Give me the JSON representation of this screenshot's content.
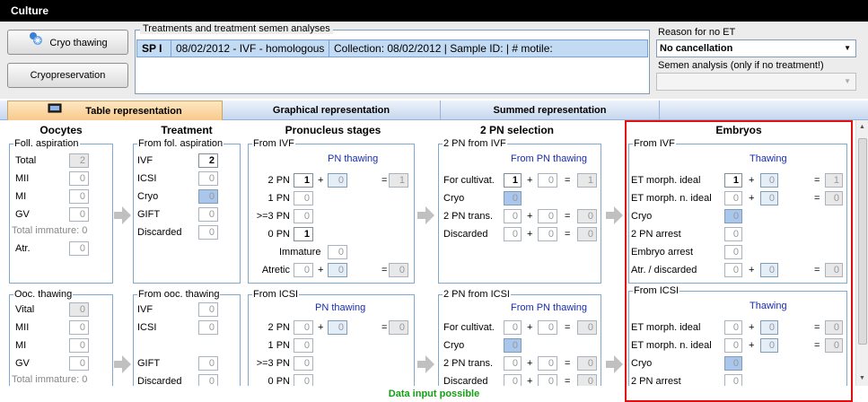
{
  "window": {
    "title": "Culture"
  },
  "toolbar": {
    "cryo_thawing": "Cryo thawing",
    "cryopreservation": "Cryopreservation"
  },
  "treatments": {
    "legend": "Treatments and treatment semen analyses",
    "row": {
      "code": "SP I",
      "date": "08/02/2012 - IVF - homologous",
      "collection": "Collection: 08/02/2012 | Sample ID:  | # motile:"
    }
  },
  "reason": {
    "label": "Reason for no ET",
    "value": "No cancellation"
  },
  "semen": {
    "label": "Semen analysis (only if no treatment!)",
    "value": ""
  },
  "tabs": [
    "Table representation",
    "Graphical representation",
    "Summed representation"
  ],
  "columns": {
    "oocytes": "Oocytes",
    "treatment": "Treatment",
    "pronucleus": "Pronucleus stages",
    "selection": "2 PN selection",
    "embryos": "Embryos"
  },
  "oocytes": {
    "aspiration": {
      "legend": "Foll. aspiration",
      "total": "Total",
      "total_v": "2",
      "mii": "MII",
      "mii_v": "0",
      "mi": "MI",
      "mi_v": "0",
      "gv": "GV",
      "gv_v": "0",
      "immature": "Total immature: 0",
      "atr": "Atr.",
      "atr_v": "0"
    },
    "thawing": {
      "legend": "Ooc. thawing",
      "vital": "Vital",
      "vital_v": "0",
      "mii": "MII",
      "mii_v": "0",
      "mi": "MI",
      "mi_v": "0",
      "gv": "GV",
      "gv_v": "0",
      "immature": "Total immature: 0"
    }
  },
  "treatment": {
    "aspiration": {
      "legend": "From fol. aspiration",
      "ivf": "IVF",
      "ivf_v": "2",
      "icsi": "ICSI",
      "icsi_v": "0",
      "cryo": "Cryo",
      "cryo_v": "0",
      "gift": "GIFT",
      "gift_v": "0",
      "discarded": "Discarded",
      "discarded_v": "0"
    },
    "thawing": {
      "legend": "From ooc. thawing",
      "ivf": "IVF",
      "ivf_v": "0",
      "icsi": "ICSI",
      "icsi_v": "0",
      "gift": "GIFT",
      "gift_v": "0",
      "discarded": "Discarded",
      "discarded_v": "0"
    }
  },
  "pronucleus": {
    "ivf": {
      "legend": "From IVF",
      "sub": "PN thawing",
      "pn2": "2 PN",
      "pn2_a": "1",
      "pn2_b": "0",
      "pn2_t": "1",
      "pn1": "1 PN",
      "pn1_v": "0",
      "pn3": ">=3 PN",
      "pn3_v": "0",
      "pn0": "0 PN",
      "pn0_v": "1",
      "immature": "Immature",
      "immature_v": "0",
      "atretic": "Atretic",
      "atretic_a": "0",
      "atretic_b": "0",
      "atretic_t": "0"
    },
    "icsi": {
      "legend": "From ICSI",
      "sub": "PN thawing",
      "pn2": "2 PN",
      "pn2_a": "0",
      "pn2_b": "0",
      "pn2_t": "0",
      "pn1": "1 PN",
      "pn1_v": "0",
      "pn3": ">=3 PN",
      "pn3_v": "0",
      "pn0": "0 PN",
      "pn0_v": "0"
    }
  },
  "selection": {
    "ivf": {
      "legend": "2 PN from IVF",
      "sub": "From PN thawing",
      "cultivat": "For cultivat.",
      "cultivat_a": "1",
      "cultivat_b": "0",
      "cultivat_t": "1",
      "cryo": "Cryo",
      "cryo_v": "0",
      "trans": "2 PN trans.",
      "trans_a": "0",
      "trans_b": "0",
      "trans_t": "0",
      "discarded": "Discarded",
      "discarded_a": "0",
      "discarded_b": "0",
      "discarded_t": "0"
    },
    "icsi": {
      "legend": "2 PN from ICSI",
      "sub": "From PN thawing",
      "cultivat": "For cultivat.",
      "cultivat_a": "0",
      "cultivat_b": "0",
      "cultivat_t": "0",
      "cryo": "Cryo",
      "cryo_v": "0",
      "trans": "2 PN trans.",
      "trans_a": "0",
      "trans_b": "0",
      "trans_t": "0",
      "discarded": "Discarded",
      "discarded_a": "0",
      "discarded_b": "0",
      "discarded_t": "0"
    }
  },
  "embryos": {
    "ivf": {
      "legend": "From IVF",
      "sub": "Thawing",
      "ideal": "ET morph. ideal",
      "ideal_a": "1",
      "ideal_b": "0",
      "ideal_t": "1",
      "nideal": "ET morph. n. ideal",
      "nideal_a": "0",
      "nideal_b": "0",
      "nideal_t": "0",
      "cryo": "Cryo",
      "cryo_v": "0",
      "arrest2": "2 PN arrest",
      "arrest2_v": "0",
      "arrest": "Embryo arrest",
      "arrest_v": "0",
      "atr": "Atr. / discarded",
      "atr_a": "0",
      "atr_b": "0",
      "atr_t": "0"
    },
    "icsi": {
      "legend": "From ICSI",
      "sub": "Thawing",
      "ideal": "ET morph. ideal",
      "ideal_a": "0",
      "ideal_b": "0",
      "ideal_t": "0",
      "nideal": "ET morph. n. ideal",
      "nideal_a": "0",
      "nideal_b": "0",
      "nideal_t": "0",
      "cryo": "Cryo",
      "cryo_v": "0",
      "arrest2": "2 PN arrest",
      "arrest2_v": "0"
    }
  },
  "ops": {
    "plus": "+",
    "eq": "="
  },
  "status": "Data input possible"
}
